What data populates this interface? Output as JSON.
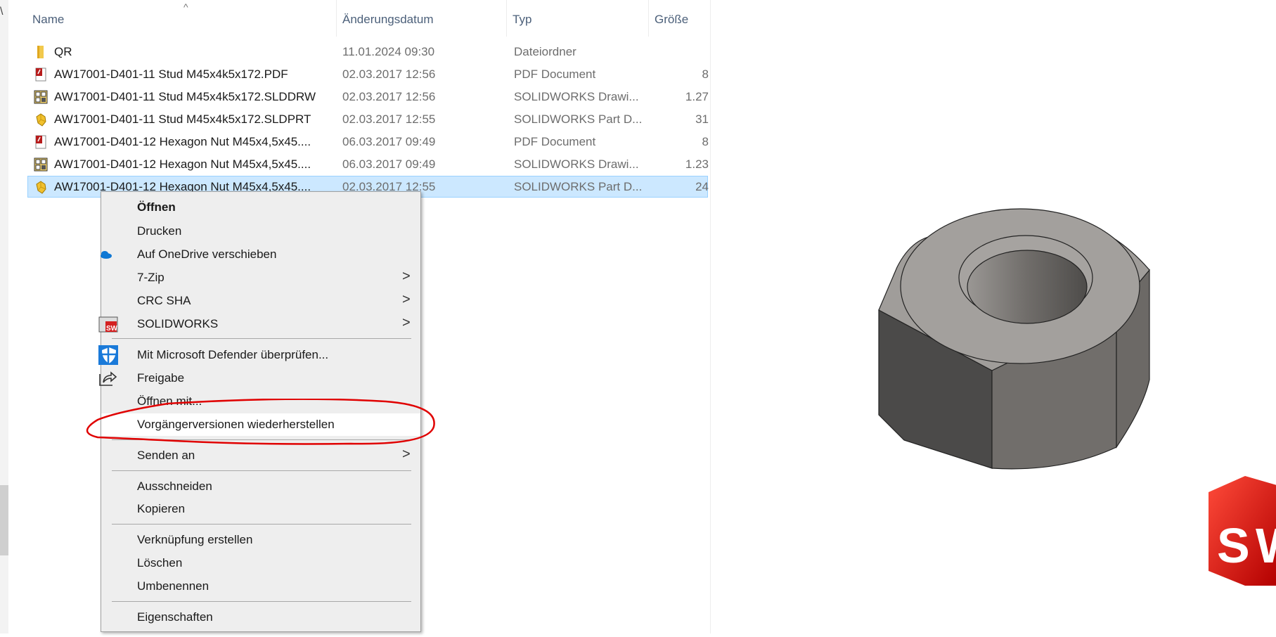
{
  "columns": {
    "name": "Name",
    "date": "Änderungsdatum",
    "type": "Typ",
    "size": "Größe"
  },
  "files": [
    {
      "name": "QR",
      "date": "11.01.2024 09:30",
      "type": "Dateiordner",
      "size": "",
      "icon": "folder-icon"
    },
    {
      "name": "AW17001-D401-11 Stud M45x4k5x172.PDF",
      "date": "02.03.2017 12:56",
      "type": "PDF Document",
      "size": "8",
      "icon": "pdf-icon"
    },
    {
      "name": "AW17001-D401-11 Stud M45x4k5x172.SLDDRW",
      "date": "02.03.2017 12:56",
      "type": "SOLIDWORKS Drawi...",
      "size": "1.27",
      "icon": "solidworks-drawing-icon"
    },
    {
      "name": "AW17001-D401-11 Stud M45x4k5x172.SLDPRT",
      "date": "02.03.2017 12:55",
      "type": "SOLIDWORKS Part D...",
      "size": "31",
      "icon": "solidworks-part-icon"
    },
    {
      "name": "AW17001-D401-12 Hexagon Nut M45x4,5x45....",
      "date": "06.03.2017 09:49",
      "type": "PDF Document",
      "size": "8",
      "icon": "pdf-icon"
    },
    {
      "name": "AW17001-D401-12 Hexagon Nut M45x4,5x45....",
      "date": "06.03.2017 09:49",
      "type": "SOLIDWORKS Drawi...",
      "size": "1.23",
      "icon": "solidworks-drawing-icon"
    },
    {
      "name": "AW17001-D401-12 Hexagon Nut M45x4,5x45....",
      "date": "02.03.2017 12:55",
      "type": "SOLIDWORKS Part D...",
      "size": "24",
      "icon": "solidworks-part-icon",
      "selected": true
    }
  ],
  "context_menu": {
    "open": "Öffnen",
    "print": "Drucken",
    "onedrive": "Auf OneDrive verschieben",
    "zip": "7-Zip",
    "crc": "CRC SHA",
    "solidworks": "SOLIDWORKS",
    "defender": "Mit Microsoft Defender überprüfen...",
    "share": "Freigabe",
    "open_with": "Öffnen mit...",
    "restore": "Vorgängerversionen wiederherstellen",
    "send_to": "Senden an",
    "cut": "Ausschneiden",
    "copy": "Kopieren",
    "shortcut": "Verknüpfung erstellen",
    "delete": "Löschen",
    "rename": "Umbenennen",
    "properties": "Eigenschaften"
  },
  "annotation_color": "#e00000",
  "logo_text": "SW"
}
